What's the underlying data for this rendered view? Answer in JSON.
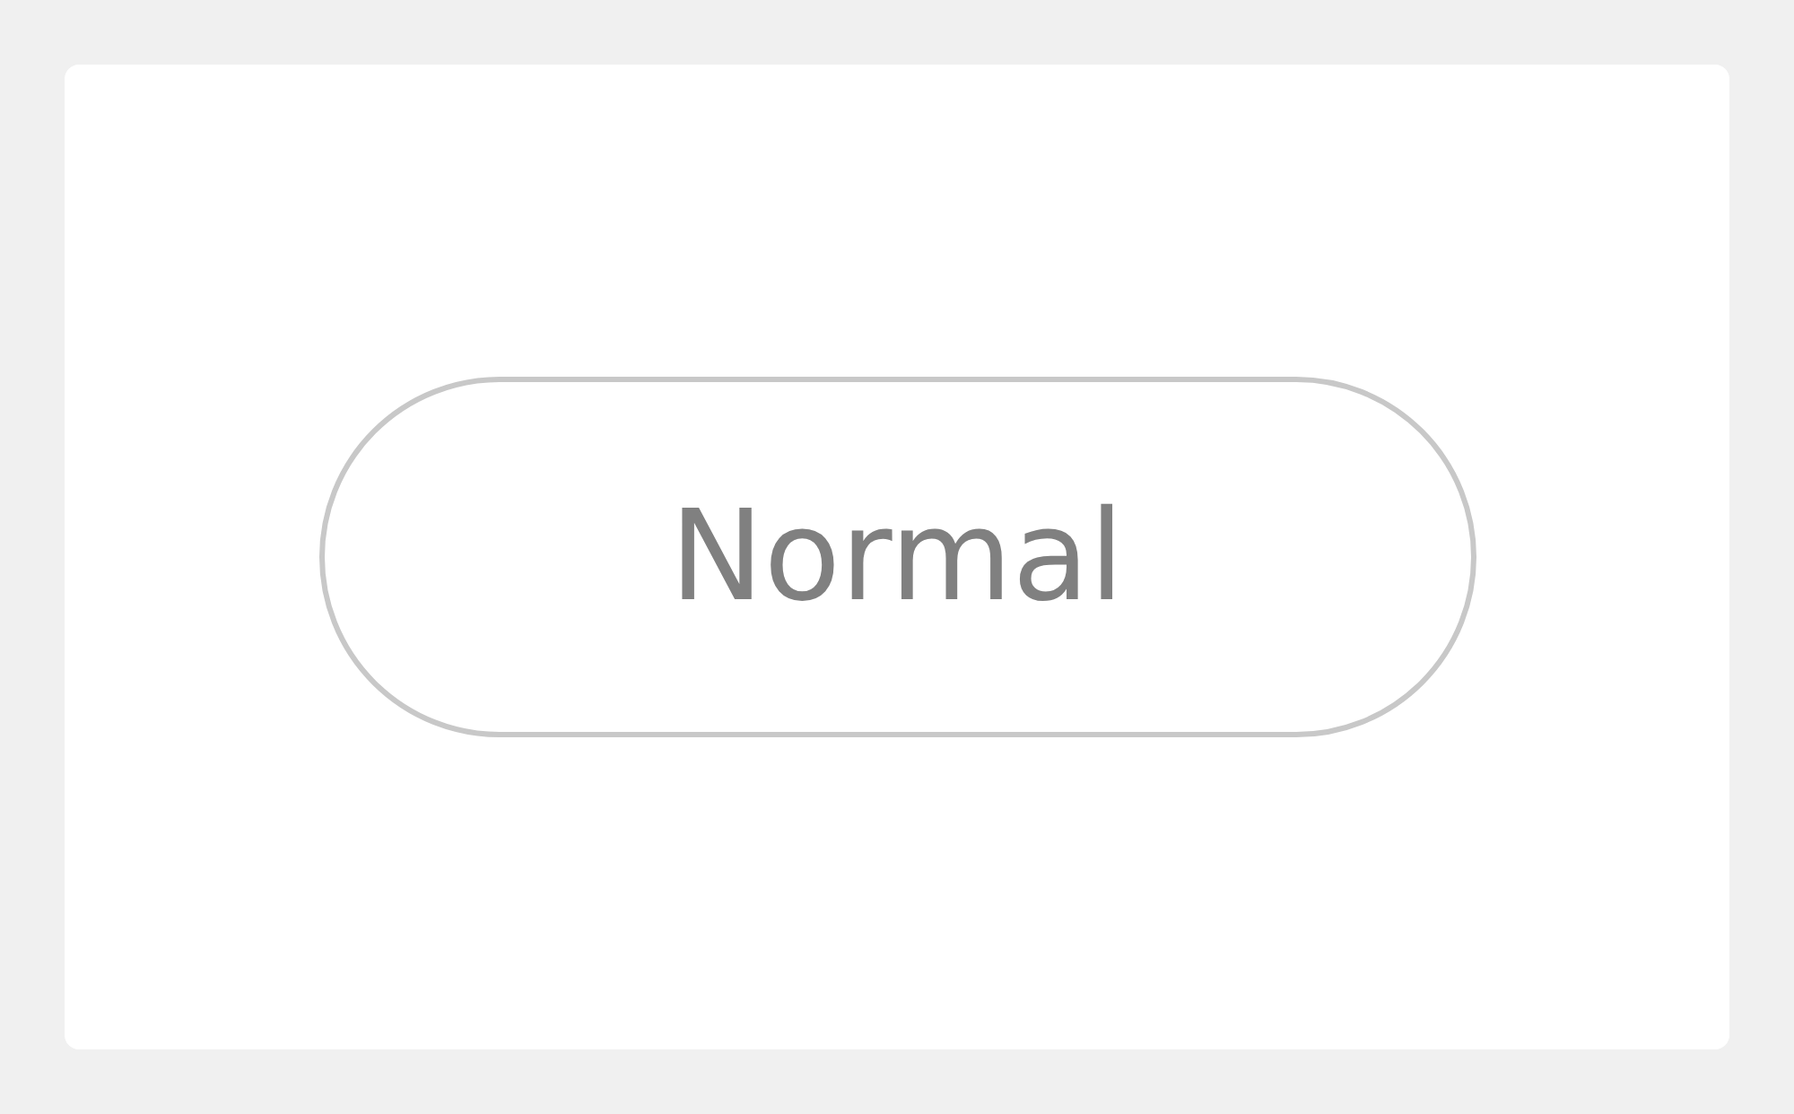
{
  "button": {
    "label": "Normal"
  }
}
